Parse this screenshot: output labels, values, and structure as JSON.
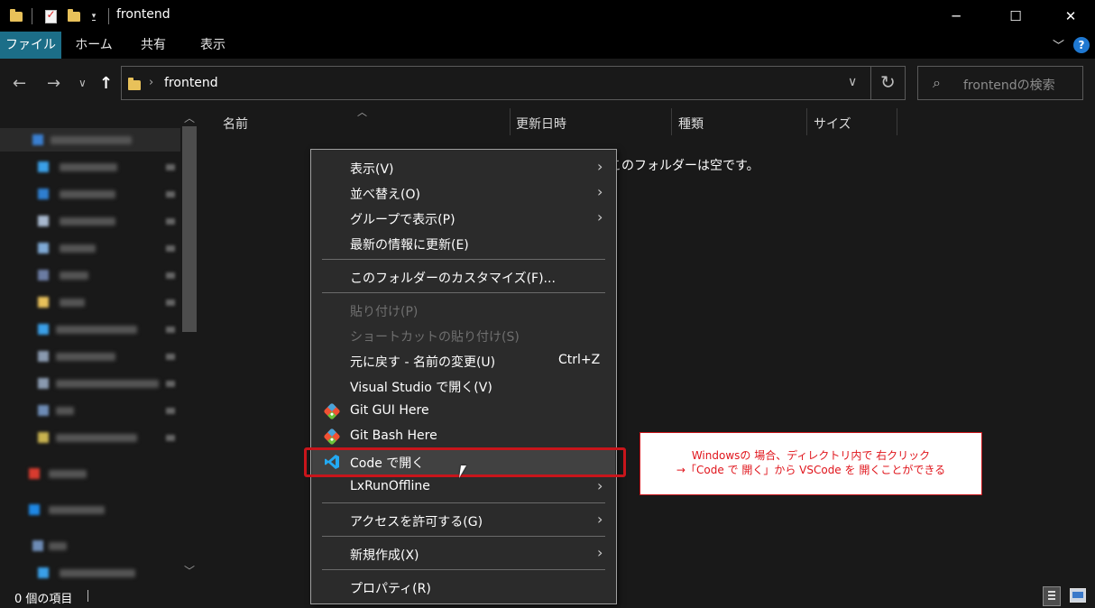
{
  "window": {
    "title": "frontend",
    "minimize": "─",
    "maximize": "☐",
    "close": "✕"
  },
  "ribbon": {
    "tabs": [
      "ファイル",
      "ホーム",
      "共有",
      "表示"
    ],
    "help": "?"
  },
  "address": {
    "path": "frontend",
    "search_placeholder": "frontendの検索"
  },
  "columns": [
    "名前",
    "更新日時",
    "種類",
    "サイズ"
  ],
  "empty_message": "このフォルダーは空です。",
  "status": {
    "item_count": "0 個の項目"
  },
  "context_menu": {
    "items": [
      {
        "label": "表示(V)",
        "submenu": true,
        "enabled": true
      },
      {
        "label": "並べ替え(O)",
        "submenu": true,
        "enabled": true
      },
      {
        "label": "グループで表示(P)",
        "submenu": true,
        "enabled": true
      },
      {
        "label": "最新の情報に更新(E)",
        "submenu": false,
        "enabled": true
      },
      {
        "label": "このフォルダーのカスタマイズ(F)...",
        "submenu": false,
        "enabled": true
      },
      {
        "label": "貼り付け(P)",
        "submenu": false,
        "enabled": false
      },
      {
        "label": "ショートカットの貼り付け(S)",
        "submenu": false,
        "enabled": false
      },
      {
        "label": "元に戻す - 名前の変更(U)",
        "shortcut": "Ctrl+Z",
        "enabled": true
      },
      {
        "label": "Visual Studio で開く(V)",
        "submenu": false,
        "enabled": true
      },
      {
        "label": "Git GUI Here",
        "icon": "git-icon",
        "enabled": true
      },
      {
        "label": "Git Bash Here",
        "icon": "git-icon",
        "enabled": true
      },
      {
        "label": "Code で開く",
        "icon": "vscode-icon",
        "enabled": true,
        "highlighted": true
      },
      {
        "label": "LxRunOffline",
        "submenu": true,
        "enabled": true
      },
      {
        "label": "アクセスを許可する(G)",
        "submenu": true,
        "enabled": true
      },
      {
        "label": "新規作成(X)",
        "submenu": true,
        "enabled": true
      },
      {
        "label": "プロパティ(R)",
        "submenu": false,
        "enabled": true
      }
    ]
  },
  "annotation": {
    "line1": "Windowsの 場合、ディレクトリ内で 右クリック",
    "line2": "→「Code で 開く」から VSCode を 開くことができる"
  },
  "colors": {
    "accent": "#1c6e88",
    "highlight": "#c8151b"
  }
}
